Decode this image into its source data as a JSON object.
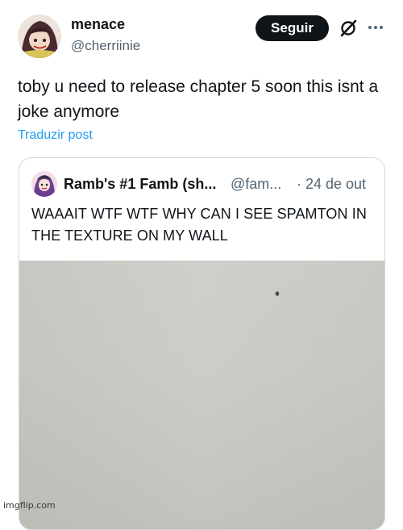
{
  "post": {
    "author": {
      "display_name": "menace",
      "handle": "@cherriinie",
      "avatar": "avatar-illustration"
    },
    "follow_label": "Seguir",
    "icons": [
      "grok-icon",
      "more-icon"
    ],
    "text": "toby u need to release chapter 5 soon this isnt a joke anymore",
    "translate_label": "Traduzir post"
  },
  "quote": {
    "author": {
      "display_name": "Ramb's #1 Famb (sh...",
      "handle": "@fam...",
      "avatar": "avatar-illustration"
    },
    "date": "· 24 de out",
    "text": "WAAAIT WTF WTF WHY CAN I SEE SPAMTON IN THE TEXTURE ON MY WALL",
    "image": "wall-texture-photo"
  },
  "watermark": "imgflip.com",
  "colors": {
    "text": "#0f1419",
    "secondary": "#536471",
    "link": "#1d9bf0",
    "border": "#cfd9de",
    "button_bg": "#0f1419",
    "button_text": "#ffffff"
  }
}
